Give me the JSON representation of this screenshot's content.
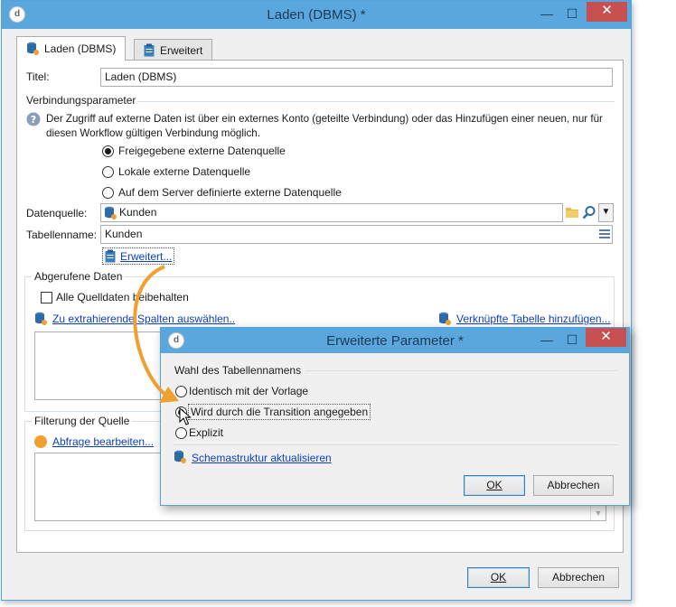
{
  "main": {
    "title": "Laden (DBMS) *",
    "minimize_glyph": "—",
    "maximize_glyph": "☐",
    "close_glyph": "✕",
    "tabs": [
      {
        "label": "Laden (DBMS)"
      },
      {
        "label": "Erweitert"
      }
    ],
    "titel_label": "Titel:",
    "titel_value": "Laden (DBMS)",
    "connection_section": "Verbindungsparameter",
    "info_line1": "Der Zugriff auf externe Daten ist über ein externes Konto (geteilte Verbindung) oder das Hinzufügen einer neuen, nur für",
    "info_line2": "diesen Workflow gültigen Verbindung möglich.",
    "radios": [
      {
        "label": "Freigegebene externe Datenquelle",
        "selected": true
      },
      {
        "label": "Lokale externe Datenquelle",
        "selected": false
      },
      {
        "label": "Auf dem Server definierte externe Datenquelle",
        "selected": false
      }
    ],
    "datasource_label": "Datenquelle:",
    "datasource_value": "Kunden",
    "tablename_label": "Tabellenname:",
    "tablename_value": "Kunden",
    "advanced_link": "Erweitert...",
    "retrieved_section": "Abgerufene Daten",
    "keep_all_label": "Alle Quelldaten beibehalten",
    "keep_all_checked": false,
    "select_columns_link": "Zu extrahierende Spalten auswählen..",
    "add_linked_table_link": "Verknüpfte Tabelle hinzufügen...",
    "filter_section": "Filterung der Quelle",
    "edit_query_link": "Abfrage bearbeiten...",
    "ok_label": "OK",
    "cancel_label": "Abbrechen"
  },
  "dialog": {
    "title": "Erweiterte Parameter *",
    "minimize_glyph": "—",
    "maximize_glyph": "☐",
    "close_glyph": "✕",
    "group_label": "Wahl des Tabellennamens",
    "options": [
      {
        "label": "Identisch mit der Vorlage",
        "selected": false
      },
      {
        "label": "Wird durch die Transition angegeben",
        "selected": true
      },
      {
        "label": "Explizit",
        "selected": false
      }
    ],
    "refresh_schema_link": "Schemastruktur aktualisieren",
    "ok_label": "OK",
    "cancel_label": "Abbrechen"
  },
  "colors": {
    "title_bar": "#5aa7de",
    "close_button": "#c75050",
    "link": "#0c3ec2",
    "annotation_arrow": "#f0a030"
  }
}
